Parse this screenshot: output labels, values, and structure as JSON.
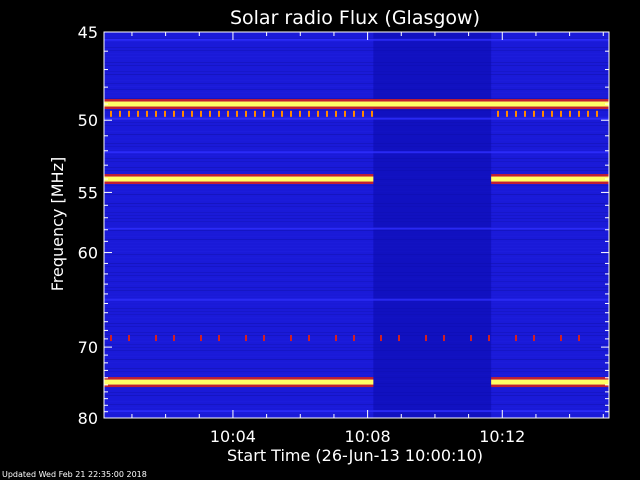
{
  "chart_data": {
    "type": "heatmap",
    "title": "Solar radio Flux (Glasgow)",
    "xlabel": "Start Time (26-Jun-13 10:00:10)",
    "ylabel": "Frequency [MHz]",
    "x_ticks": [
      "10:04",
      "10:08",
      "10:12"
    ],
    "x_tick_minutes": [
      4,
      8,
      12
    ],
    "xlim_minutes": [
      0.17,
      15.17
    ],
    "y_ticks": [
      45,
      50,
      55,
      60,
      70,
      80
    ],
    "ylim": [
      45,
      80
    ],
    "y_scale": "reciprocal",
    "gap_minutes": [
      8.17,
      11.67
    ],
    "continuous_bands": [
      {
        "freq": 49.0,
        "level": "strong"
      }
    ],
    "interrupted_bands": [
      {
        "freq": 54.0,
        "level": "strong"
      },
      {
        "freq": 74.6,
        "level": "strong"
      }
    ],
    "weak_bands": [
      45.4,
      49.9,
      52.1,
      57.9,
      64.6,
      78.9
    ],
    "spike_bands": [
      {
        "freq": 49.6,
        "level": "medium"
      },
      {
        "freq": 68.9,
        "level": "weak"
      }
    ],
    "colors": {
      "background": "#1a1ad8",
      "strong": "#ffff66",
      "medium": "#ff8800",
      "weak": "#d42020"
    }
  },
  "footer": "Updated Wed Feb 21 22:35:00 2018"
}
